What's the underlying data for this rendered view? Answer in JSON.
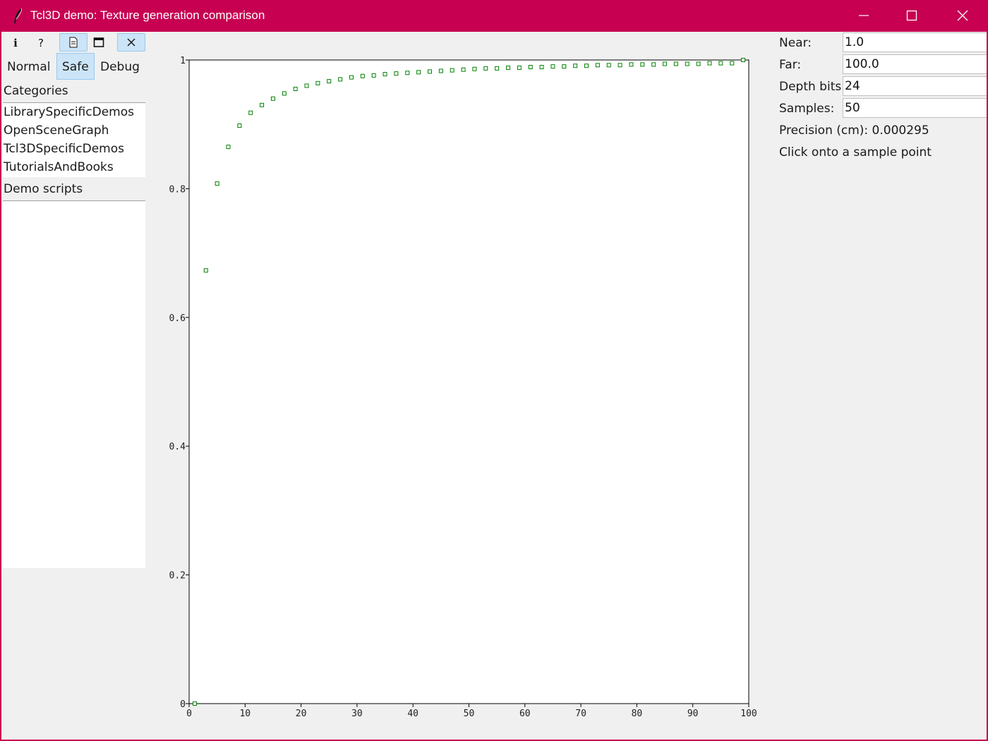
{
  "window": {
    "title": "Tcl3D demo: Texture generation comparison",
    "title_bar_color": "#c70052"
  },
  "toolbar": {
    "buttons": [
      {
        "icon": "info-icon",
        "label": "i"
      },
      {
        "icon": "help-icon",
        "label": "?"
      },
      {
        "icon": "document-icon",
        "active": true
      },
      {
        "icon": "maximize-icon"
      },
      {
        "icon": "close-icon",
        "active": true
      }
    ],
    "modes": [
      "Normal",
      "Safe",
      "Debug"
    ],
    "active_mode": "Safe",
    "accent_color": "#cce4f7"
  },
  "sidebar": {
    "categories_label": "Categories",
    "categories": [
      "LibrarySpecificDemos",
      "OpenSceneGraph",
      "Tcl3DSpecificDemos",
      "TutorialsAndBooks"
    ],
    "demo_scripts_label": "Demo scripts",
    "demo_scripts": []
  },
  "settings": {
    "near_label": "Near:",
    "near_value": "1.0",
    "far_label": "Far:",
    "far_value": "100.0",
    "depth_bits_label": "Depth bits:",
    "depth_bits_value": "24",
    "samples_label": "Samples:",
    "samples_value": "50",
    "precision_text": "Precision (cm): 0.000295",
    "hint_text": "Click onto a sample point"
  },
  "chart_data": {
    "type": "scatter",
    "marker": "hollow-square",
    "color": "#008000",
    "xlim": [
      0,
      100
    ],
    "ylim": [
      0,
      1
    ],
    "x_ticks": [
      "0",
      "10",
      "20",
      "30",
      "40",
      "50",
      "60",
      "70",
      "80",
      "90",
      "100"
    ],
    "y_ticks": [
      "0",
      "0.2",
      "0.4",
      "0.6",
      "0.8",
      "1"
    ],
    "grid": false,
    "legend": false,
    "x": [
      1,
      3,
      5,
      7,
      9,
      11,
      13,
      15,
      17,
      19,
      21,
      23,
      25,
      27,
      29,
      31,
      33,
      35,
      37,
      39,
      41,
      43,
      45,
      47,
      49,
      51,
      53,
      55,
      57,
      59,
      61,
      63,
      65,
      67,
      69,
      71,
      73,
      75,
      77,
      79,
      81,
      83,
      85,
      87,
      89,
      91,
      93,
      95,
      97,
      99
    ],
    "y": [
      0,
      0.673,
      0.808,
      0.865,
      0.898,
      0.918,
      0.93,
      0.94,
      0.948,
      0.955,
      0.96,
      0.964,
      0.967,
      0.97,
      0.973,
      0.975,
      0.976,
      0.978,
      0.979,
      0.98,
      0.981,
      0.982,
      0.983,
      0.984,
      0.985,
      0.986,
      0.987,
      0.987,
      0.988,
      0.988,
      0.989,
      0.989,
      0.99,
      0.99,
      0.991,
      0.991,
      0.992,
      0.992,
      0.992,
      0.993,
      0.993,
      0.993,
      0.994,
      0.994,
      0.994,
      0.994,
      0.995,
      0.995,
      0.995,
      1.0
    ]
  }
}
